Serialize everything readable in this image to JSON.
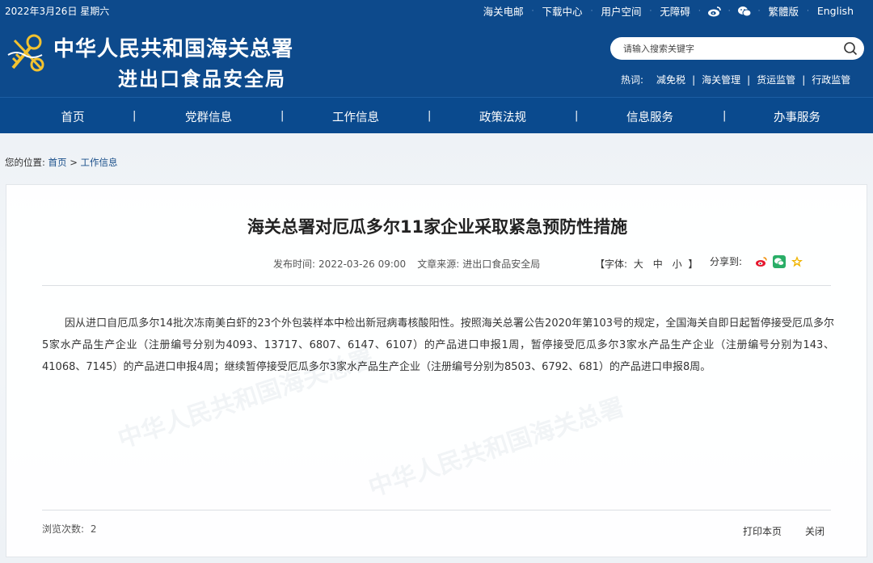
{
  "topbar": {
    "date": "2022年3月26日 星期六",
    "links": [
      "海关电邮",
      "下载中心",
      "用户空间",
      "无障碍"
    ],
    "weibo_icon": "weibo-icon",
    "wechat_icon": "wechat-icon",
    "traditional": "繁體版",
    "english": "English"
  },
  "header": {
    "title_line1": "中华人民共和国海关总署",
    "title_line2": "进出口食品安全局",
    "search_placeholder": "请输入搜索关键字",
    "hot_label": "热词:",
    "hot_words": [
      "减免税",
      "海关管理",
      "货运监管",
      "行政监管"
    ]
  },
  "nav": {
    "items": [
      "首页",
      "党群信息",
      "工作信息",
      "政策法规",
      "信息服务",
      "办事服务"
    ]
  },
  "breadcrumb": {
    "prefix": "您的位置:",
    "home": "首页",
    "arrow": ">",
    "current": "工作信息"
  },
  "article": {
    "title": "海关总署对厄瓜多尔11家企业采取紧急预防性措施",
    "publish_label": "发布时间:",
    "publish_time": "2022-03-26 09:00",
    "source_label": "文章来源:",
    "source": "进出口食品安全局",
    "font_label_open": "【字体:",
    "font_sizes": [
      "大",
      "中",
      "小"
    ],
    "font_label_close": "】",
    "share_label": "分享到:",
    "body": "因从进口自厄瓜多尔14批次冻南美白虾的23个外包装样本中检出新冠病毒核酸阳性。按照海关总署公告2020年第103号的规定，全国海关自即日起暂停接受厄瓜多尔5家水产品生产企业（注册编号分别为4093、13717、6807、6147、6107）的产品进口申报1周，暂停接受厄瓜多尔3家水产品生产企业（注册编号分别为143、41068、7145）的产品进口申报4周；继续暂停接受厄瓜多尔3家水产品生产企业（注册编号分别为8503、6792、681）的产品进口申报8周。",
    "views_label": "浏览次数:",
    "views": "2",
    "print_label": "打印本页",
    "close_label": "关闭"
  },
  "watermark_text": "中华人民共和国海关总署",
  "colors": {
    "header_blue": "#0d4a8c",
    "nav_blue": "#0a4a8e",
    "link_blue": "#1a4f8a",
    "weibo_red": "#e6162d",
    "wechat_green": "#2aae67",
    "favorite_gold": "#f0b400"
  }
}
